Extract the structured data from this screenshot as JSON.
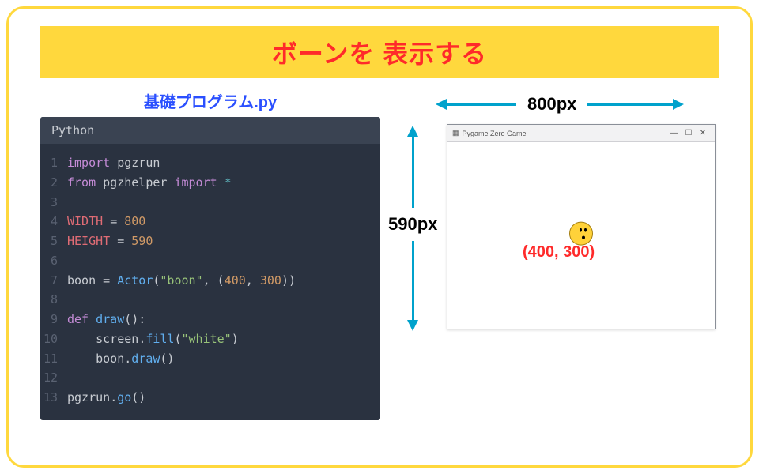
{
  "title": "ボーンを 表示する",
  "filename": "基礎プログラム.py",
  "editor_lang": "Python",
  "code_lines": [
    [
      {
        "t": "kw",
        "v": "import"
      },
      {
        "t": "sp",
        "v": " "
      },
      {
        "t": "id",
        "v": "pgzrun"
      }
    ],
    [
      {
        "t": "kw",
        "v": "from"
      },
      {
        "t": "sp",
        "v": " "
      },
      {
        "t": "id",
        "v": "pgzhelper"
      },
      {
        "t": "sp",
        "v": " "
      },
      {
        "t": "kw",
        "v": "import"
      },
      {
        "t": "sp",
        "v": " "
      },
      {
        "t": "star",
        "v": "*"
      }
    ],
    [],
    [
      {
        "t": "var",
        "v": "WIDTH"
      },
      {
        "t": "sp",
        "v": " "
      },
      {
        "t": "op",
        "v": "="
      },
      {
        "t": "sp",
        "v": " "
      },
      {
        "t": "num",
        "v": "800"
      }
    ],
    [
      {
        "t": "var",
        "v": "HEIGHT"
      },
      {
        "t": "sp",
        "v": " "
      },
      {
        "t": "op",
        "v": "="
      },
      {
        "t": "sp",
        "v": " "
      },
      {
        "t": "num",
        "v": "590"
      }
    ],
    [],
    [
      {
        "t": "id",
        "v": "boon"
      },
      {
        "t": "sp",
        "v": " "
      },
      {
        "t": "op",
        "v": "="
      },
      {
        "t": "sp",
        "v": " "
      },
      {
        "t": "fn",
        "v": "Actor"
      },
      {
        "t": "op",
        "v": "("
      },
      {
        "t": "str",
        "v": "\"boon\""
      },
      {
        "t": "op",
        "v": ", ("
      },
      {
        "t": "num",
        "v": "400"
      },
      {
        "t": "op",
        "v": ", "
      },
      {
        "t": "num",
        "v": "300"
      },
      {
        "t": "op",
        "v": "))"
      }
    ],
    [],
    [
      {
        "t": "kw",
        "v": "def"
      },
      {
        "t": "sp",
        "v": " "
      },
      {
        "t": "fn",
        "v": "draw"
      },
      {
        "t": "op",
        "v": "():"
      }
    ],
    [
      {
        "t": "sp",
        "v": "    "
      },
      {
        "t": "id",
        "v": "screen"
      },
      {
        "t": "op",
        "v": "."
      },
      {
        "t": "fn",
        "v": "fill"
      },
      {
        "t": "op",
        "v": "("
      },
      {
        "t": "str",
        "v": "\"white\""
      },
      {
        "t": "op",
        "v": ")"
      }
    ],
    [
      {
        "t": "sp",
        "v": "    "
      },
      {
        "t": "id",
        "v": "boon"
      },
      {
        "t": "op",
        "v": "."
      },
      {
        "t": "fn",
        "v": "draw"
      },
      {
        "t": "op",
        "v": "()"
      }
    ],
    [],
    [
      {
        "t": "id",
        "v": "pgzrun"
      },
      {
        "t": "op",
        "v": "."
      },
      {
        "t": "fn",
        "v": "go"
      },
      {
        "t": "op",
        "v": "()"
      }
    ]
  ],
  "dim_width_label": "800px",
  "dim_height_label": "590px",
  "window_title": "Pygame Zero Game",
  "coord_label": "(400, 300)"
}
